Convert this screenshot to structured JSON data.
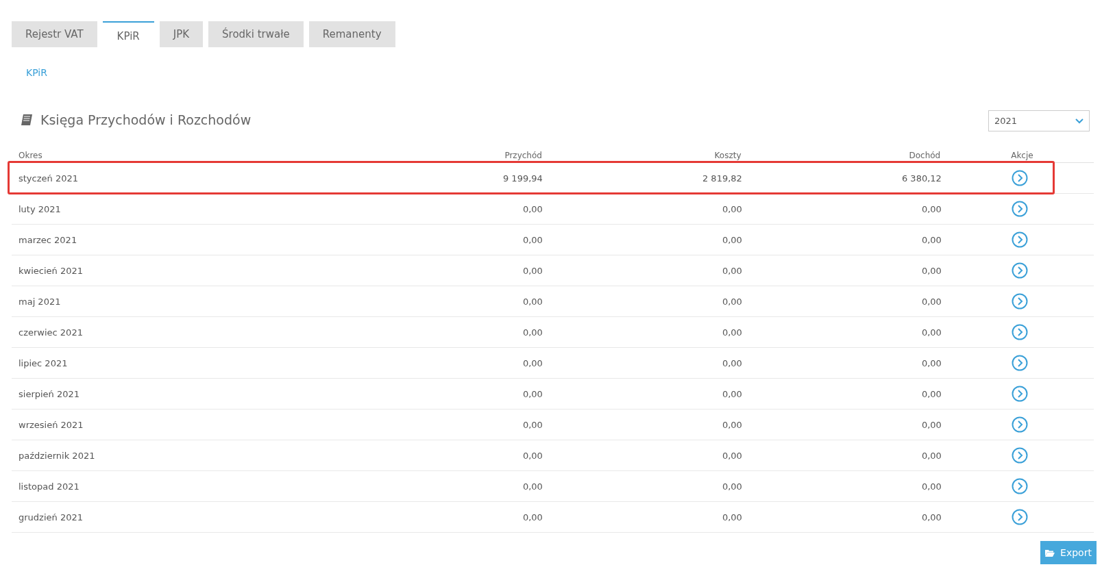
{
  "tabs": [
    {
      "label": "Rejestr VAT",
      "selected": false
    },
    {
      "label": "KPiR",
      "selected": true
    },
    {
      "label": "JPK",
      "selected": false
    },
    {
      "label": "Środki trwałe",
      "selected": false
    },
    {
      "label": "Remanenty",
      "selected": false
    }
  ],
  "breadcrumb": "KPiR",
  "heading": "Księga Przychodów i Rozchodów",
  "year_select": {
    "value": "2021"
  },
  "table": {
    "columns": [
      "Okres",
      "Przychód",
      "Koszty",
      "Dochód",
      "Akcje"
    ],
    "rows": [
      {
        "period": "styczeń 2021",
        "income": "9 199,94",
        "costs": "2 819,82",
        "profit": "6 380,12",
        "highlighted": true
      },
      {
        "period": "luty 2021",
        "income": "0,00",
        "costs": "0,00",
        "profit": "0,00",
        "highlighted": false
      },
      {
        "period": "marzec 2021",
        "income": "0,00",
        "costs": "0,00",
        "profit": "0,00",
        "highlighted": false
      },
      {
        "period": "kwiecień 2021",
        "income": "0,00",
        "costs": "0,00",
        "profit": "0,00",
        "highlighted": false
      },
      {
        "period": "maj 2021",
        "income": "0,00",
        "costs": "0,00",
        "profit": "0,00",
        "highlighted": false
      },
      {
        "period": "czerwiec 2021",
        "income": "0,00",
        "costs": "0,00",
        "profit": "0,00",
        "highlighted": false
      },
      {
        "period": "lipiec 2021",
        "income": "0,00",
        "costs": "0,00",
        "profit": "0,00",
        "highlighted": false
      },
      {
        "period": "sierpień 2021",
        "income": "0,00",
        "costs": "0,00",
        "profit": "0,00",
        "highlighted": false
      },
      {
        "period": "wrzesień 2021",
        "income": "0,00",
        "costs": "0,00",
        "profit": "0,00",
        "highlighted": false
      },
      {
        "period": "październik 2021",
        "income": "0,00",
        "costs": "0,00",
        "profit": "0,00",
        "highlighted": false
      },
      {
        "period": "listopad 2021",
        "income": "0,00",
        "costs": "0,00",
        "profit": "0,00",
        "highlighted": false
      },
      {
        "period": "grudzień 2021",
        "income": "0,00",
        "costs": "0,00",
        "profit": "0,00",
        "highlighted": false
      }
    ]
  },
  "export_button": "Export"
}
